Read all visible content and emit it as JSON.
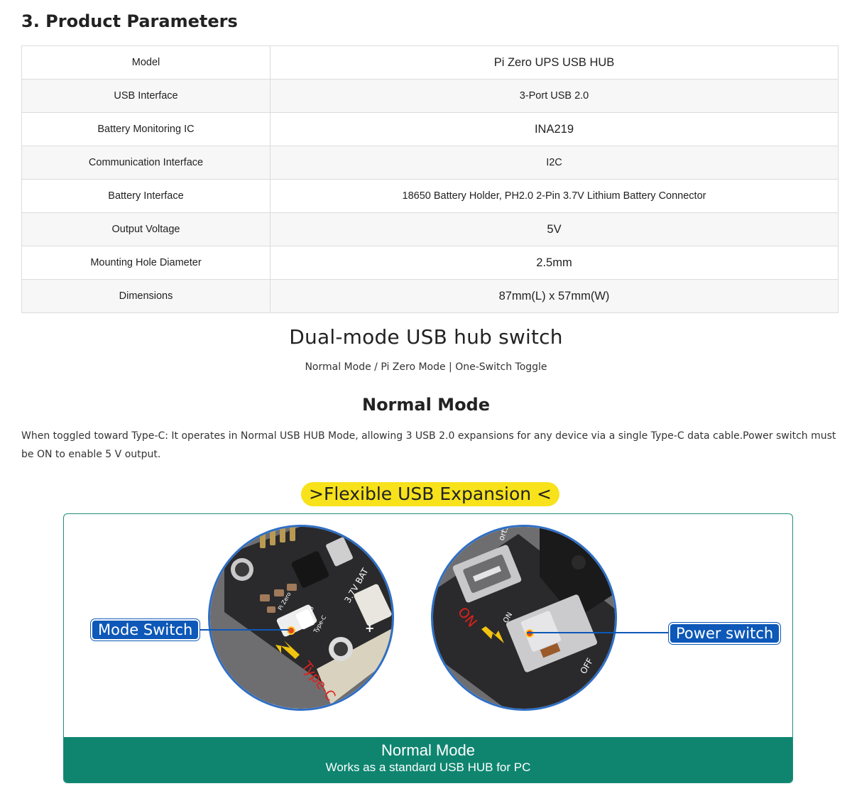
{
  "section_title": "3. Product Parameters",
  "params": [
    {
      "label": "Model",
      "value": "Pi Zero UPS USB HUB"
    },
    {
      "label": "USB Interface",
      "value": "3-Port USB 2.0"
    },
    {
      "label": "Battery Monitoring IC",
      "value": "INA219"
    },
    {
      "label": "Communication Interface",
      "value": "I2C"
    },
    {
      "label": "Battery Interface",
      "value": "18650 Battery Holder, PH2.0 2-Pin 3.7V Lithium Battery Connector"
    },
    {
      "label": "Output Voltage",
      "value": "5V"
    },
    {
      "label": "Mounting Hole Diameter",
      "value": "2.5mm"
    },
    {
      "label": "Dimensions",
      "value": "87mm(L) x 57mm(W)"
    }
  ],
  "feature": {
    "heading": "Dual-mode USB hub switch",
    "subline": "Normal Mode / Pi Zero Mode | One-Switch Toggle",
    "mode_heading": "Normal Mode",
    "description": "When toggled toward Type-C: It operates in Normal USB HUB Mode, allowing 3 USB 2.0 expansions for any device via a single Type-C data cable.Power switch must be ON to enable 5 V output."
  },
  "figure": {
    "pill_text": ">Flexible USB Expansion <",
    "mode_switch_label": "Mode Switch",
    "power_switch_label": "Power switch",
    "board_text": {
      "bat": "3.7V BAT",
      "pizero": "Pi Zero",
      "usb": "USB",
      "typec_small": "Type-C",
      "typec_big": "Type-C",
      "port": "ort3",
      "on_red": "ON",
      "on_small": "ON",
      "off": "OFF"
    },
    "banner_title": "Normal Mode",
    "banner_subtitle": "Works as a standard USB HUB for PC"
  },
  "colors": {
    "accent_green": "#0f8570",
    "label_blue": "#0d58b8",
    "pill_yellow": "#f7e21b",
    "arrow_yellow": "#f1c40f",
    "red_text": "#e0201b"
  }
}
